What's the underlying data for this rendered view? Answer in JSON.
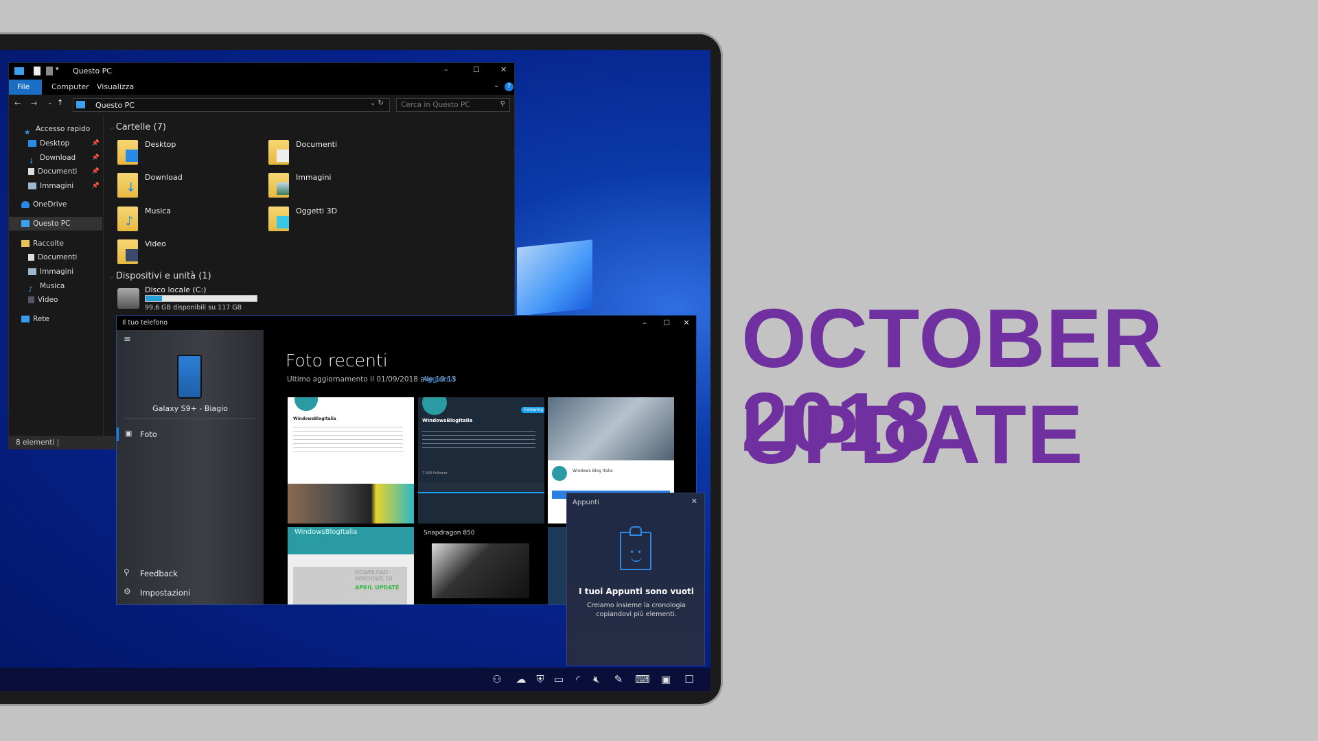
{
  "headline": {
    "line1": "OCTOBER 2018",
    "line2": "UPDATE",
    "color": "#7030a0"
  },
  "explorer": {
    "title": "Questo PC",
    "ribbon_tabs": [
      "File",
      "Computer",
      "Visualizza"
    ],
    "address": "Questo PC",
    "search_placeholder": "Cerca in Questo PC",
    "nav": [
      {
        "label": "Accesso rapido",
        "icon": "star-icon"
      },
      {
        "label": "Desktop",
        "icon": "desktop-icon",
        "pinned": true
      },
      {
        "label": "Download",
        "icon": "download-icon",
        "pinned": true
      },
      {
        "label": "Documenti",
        "icon": "document-icon",
        "pinned": true
      },
      {
        "label": "Immagini",
        "icon": "pictures-icon",
        "pinned": true
      },
      {
        "label": "OneDrive",
        "icon": "cloud-icon"
      },
      {
        "label": "Questo PC",
        "icon": "computer-icon",
        "selected": true
      },
      {
        "label": "Raccolte",
        "icon": "library-icon"
      },
      {
        "label": "Documenti",
        "icon": "document-icon"
      },
      {
        "label": "Immagini",
        "icon": "pictures-icon"
      },
      {
        "label": "Musica",
        "icon": "music-icon"
      },
      {
        "label": "Video",
        "icon": "video-icon"
      },
      {
        "label": "Rete",
        "icon": "network-icon"
      }
    ],
    "folders_header": "Cartelle (7)",
    "folders": [
      "Desktop",
      "Documenti",
      "Download",
      "Immagini",
      "Musica",
      "Oggetti 3D",
      "Video"
    ],
    "devices_header": "Dispositivi e unità (1)",
    "drive": {
      "name": "Disco locale (C:)",
      "free": "99,6 GB disponibili su 117 GB",
      "used_fraction": 0.15
    },
    "status": "8 elementi"
  },
  "phone_app": {
    "title": "Il tuo telefono",
    "device": "Galaxy S9+ - Biagio",
    "nav": [
      "Foto"
    ],
    "footer": [
      "Feedback",
      "Impostazioni"
    ],
    "heading": "Foto recenti",
    "updated": "Ultimo aggiornamento il 01/09/2018 alle 10:13",
    "refresh": "Aggiorna",
    "thumb_texts": {
      "t1": "WindowsBlogItalia",
      "t2": "WindowsBlogItalia",
      "t3": "Windows Blog Italia",
      "t4": "WindowsBlogItalia",
      "t5": "Snapdragon 850",
      "t6": "DOWNLOAD WINDOWS 10",
      "t7": "APRIL UPDATE",
      "t8": "Following",
      "t9": "7.393 Follower"
    }
  },
  "clipboard": {
    "title": "Appunti",
    "empty_title": "I tuoi Appunti sono vuoti",
    "empty_text": "Creiamo insieme la cronologia copiandovi più elementi."
  },
  "taskbar": [
    "people-icon",
    "onedrive-icon",
    "defender-icon",
    "battery-icon",
    "wifi-icon",
    "volume-muted-icon",
    "pen-icon",
    "keyboard-icon",
    "touchpad-icon",
    "action-center-icon"
  ]
}
